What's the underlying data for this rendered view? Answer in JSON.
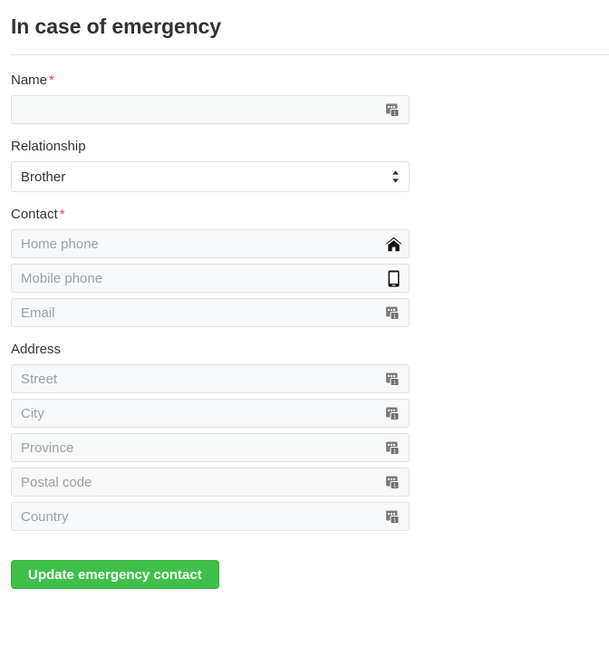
{
  "header": {
    "title": "In case of emergency"
  },
  "form": {
    "name_group": {
      "label": "Name",
      "required_marker": "*",
      "input": {
        "value": "",
        "placeholder": "",
        "icon": "input-box-icon"
      }
    },
    "relationship_group": {
      "label": "Relationship",
      "select": {
        "selected": "Brother",
        "options": [
          "Brother"
        ],
        "icon": "updown-chevron-icon"
      }
    },
    "contact_group": {
      "label": "Contact",
      "required_marker": "*",
      "fields": [
        {
          "placeholder": "Home phone",
          "value": "",
          "icon": "home-icon"
        },
        {
          "placeholder": "Mobile phone",
          "value": "",
          "icon": "mobile-phone-icon"
        },
        {
          "placeholder": "Email",
          "value": "",
          "icon": "input-box-icon"
        }
      ]
    },
    "address_group": {
      "label": "Address",
      "fields": [
        {
          "placeholder": "Street",
          "value": "",
          "icon": "input-box-icon"
        },
        {
          "placeholder": "City",
          "value": "",
          "icon": "input-box-icon"
        },
        {
          "placeholder": "Province",
          "value": "",
          "icon": "input-box-icon"
        },
        {
          "placeholder": "Postal code",
          "value": "",
          "icon": "input-box-icon"
        },
        {
          "placeholder": "Country",
          "value": "",
          "icon": "input-box-icon"
        }
      ]
    },
    "submit": {
      "label": "Update emergency contact"
    }
  },
  "colors": {
    "button_green": "#3ec04b",
    "required_red": "#e8443a",
    "title_dark": "#2d3339",
    "input_bg": "#f8f9fa",
    "input_border": "#dfe2e5",
    "placeholder_grey": "#9aa0a6",
    "icon_grey": "#808080",
    "icon_black": "#1b1b1b"
  }
}
